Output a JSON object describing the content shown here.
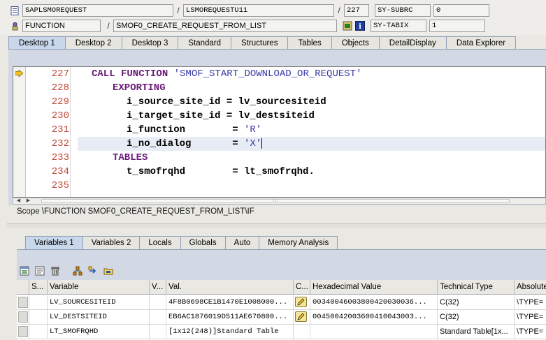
{
  "header": {
    "row1": {
      "program": "SAPLSMOREQUEST",
      "include": "LSMOREQUESTU11",
      "line": "227",
      "sysfield_name": "SY-SUBRC",
      "sysfield_value": "0"
    },
    "row2": {
      "type": "FUNCTION",
      "name": "SMOF0_CREATE_REQUEST_FROM_LIST",
      "sysfield_name": "SY-TABIX",
      "sysfield_value": "1"
    },
    "separator": "/"
  },
  "desktop_tabs": [
    "Desktop 1",
    "Desktop 2",
    "Desktop 3",
    "Standard",
    "Structures",
    "Tables",
    "Objects",
    "DetailDisplay",
    "Data Explorer"
  ],
  "code": {
    "lines": [
      {
        "num": "227"
      },
      {
        "num": "228"
      },
      {
        "num": "229"
      },
      {
        "num": "230"
      },
      {
        "num": "231"
      },
      {
        "num": "232"
      },
      {
        "num": "233"
      },
      {
        "num": "234"
      },
      {
        "num": "235"
      }
    ],
    "l227_kw": "CALL FUNCTION",
    "l227_str": "'SMOF_START_DOWNLOAD_OR_REQUEST'",
    "l228_kw": "EXPORTING",
    "l229": "i_source_site_id = lv_sourcesiteid",
    "l230": "i_target_site_id = lv_destsiteid",
    "l231_param": "i_function        = ",
    "l231_str": "'R'",
    "l232_param": "i_no_dialog       = ",
    "l232_str": "'X'",
    "l233_kw": "TABLES",
    "l234": "t_smofrqhd        = lt_smofrqhd."
  },
  "scope": "Scope \\FUNCTION SMOF0_CREATE_REQUEST_FROM_LIST\\IF",
  "var_tabs": [
    "Variables 1",
    "Variables 2",
    "Locals",
    "Globals",
    "Auto",
    "Memory Analysis"
  ],
  "grid": {
    "headers": [
      "S...",
      "Variable",
      "V...",
      "Val.",
      "C...",
      "Hexadecimal Value",
      "Technical Type",
      "Absolute"
    ],
    "rows": [
      {
        "variable": "LV_SOURCESITEID",
        "value": "4F8B0698CE1B1470E1008000...",
        "hex": "00340046003800420030036...",
        "type": "C(32)",
        "abs": "\\TYPE="
      },
      {
        "variable": "LV_DESTSITEID",
        "value": "EB6AC1876019D511AE670800...",
        "hex": "00450042003600410043003...",
        "type": "C(32)",
        "abs": "\\TYPE="
      },
      {
        "variable": "LT_SMOFRQHD",
        "value": "[1x12(248)]Standard Table",
        "hex": "",
        "type": "Standard Table[1x...",
        "abs": "\\TYPE="
      }
    ]
  }
}
